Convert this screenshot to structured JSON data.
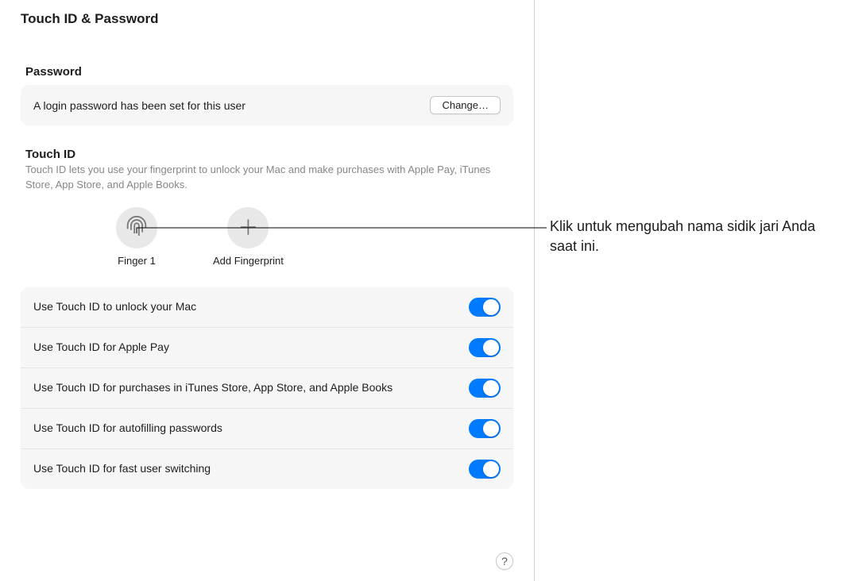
{
  "window": {
    "title": "Touch ID & Password"
  },
  "password": {
    "section_title": "Password",
    "status": "A login password has been set for this user",
    "change_label": "Change…"
  },
  "touchid": {
    "title": "Touch ID",
    "description": "Touch ID lets you use your fingerprint to unlock your Mac and make purchases with Apple Pay, iTunes Store, App Store, and Apple Books.",
    "finger_label": "Finger 1",
    "add_label": "Add Fingerprint"
  },
  "toggles": [
    {
      "label": "Use Touch ID to unlock your Mac",
      "on": true
    },
    {
      "label": "Use Touch ID for Apple Pay",
      "on": true
    },
    {
      "label": "Use Touch ID for purchases in iTunes Store, App Store, and Apple Books",
      "on": true
    },
    {
      "label": "Use Touch ID for autofilling passwords",
      "on": true
    },
    {
      "label": "Use Touch ID for fast user switching",
      "on": true
    }
  ],
  "help": {
    "label": "?"
  },
  "callout": {
    "text": "Klik untuk mengubah nama sidik jari Anda saat ini."
  }
}
